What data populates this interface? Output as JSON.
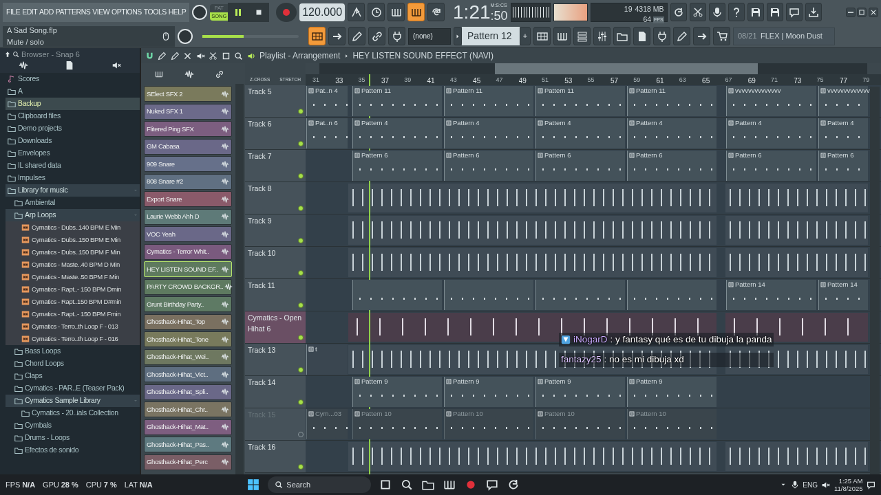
{
  "menu": [
    "FILE",
    "EDIT",
    "ADD",
    "PATTERNS",
    "VIEW",
    "OPTIONS",
    "TOOLS",
    "HELP"
  ],
  "mode": [
    {
      "label": "PAT",
      "selected": false
    },
    {
      "label": "SONG",
      "selected": true
    }
  ],
  "transport": {
    "playing": true,
    "tempo": "120.000"
  },
  "toggles": [
    {
      "on": false
    },
    {
      "on": false
    },
    {
      "on": false
    },
    {
      "on": true
    },
    {
      "on": false
    }
  ],
  "time": {
    "value": "1:21",
    "sub": ":50",
    "unit": "M:S:CS"
  },
  "cpu": {
    "polyphony": "19",
    "memory": "4318 MB",
    "fps": "64",
    "fps_label": "FPS"
  },
  "project": {
    "file": "A Sad Song.flp",
    "hint": "Mute / solo"
  },
  "master_volume": {
    "level": 0.43
  },
  "tool_toggles": [
    {
      "on": true
    },
    {
      "on": false
    },
    {
      "on": false
    },
    {
      "on": false
    },
    {
      "on": false
    }
  ],
  "pattern_picker": {
    "preset": "(none)",
    "pattern": "Pattern 12",
    "add": "+"
  },
  "news": {
    "counter": "08/21",
    "title": "FLEX | Moon Dust"
  },
  "browser": {
    "title": "Browser - Snap 6",
    "items": [
      {
        "label": "Scores",
        "kind": "score",
        "selected": false
      },
      {
        "label": "A",
        "kind": "folder",
        "selected": false
      },
      {
        "label": "Backup",
        "kind": "folder",
        "selected": true
      },
      {
        "label": "Clipboard files",
        "kind": "folder",
        "selected": false
      },
      {
        "label": "Demo projects",
        "kind": "folder",
        "selected": false
      },
      {
        "label": "Downloads",
        "kind": "folder",
        "selected": false
      },
      {
        "label": "Envelopes",
        "kind": "folder",
        "selected": false
      },
      {
        "label": "IL shared data",
        "kind": "folder",
        "selected": false
      },
      {
        "label": "Impulses",
        "kind": "folder",
        "selected": false
      },
      {
        "label": "Library for music",
        "kind": "folder",
        "selected": false,
        "children": [
          {
            "label": "Ambiental",
            "kind": "folder",
            "selected": false
          },
          {
            "label": "Arp Loops",
            "kind": "folder",
            "selected": false,
            "children": [
              {
                "label": "Cymatics - Dubs..140 BPM E Min",
                "kind": "file",
                "selected": false
              },
              {
                "label": "Cymatics - Dubs..150 BPM E Min",
                "kind": "file",
                "selected": false
              },
              {
                "label": "Cymatics - Dubs..150 BPM F Min",
                "kind": "file",
                "selected": false
              },
              {
                "label": "Cymatics - Maste..40 BPM D Min",
                "kind": "file",
                "selected": false
              },
              {
                "label": "Cymatics - Maste..50 BPM F Min",
                "kind": "file",
                "selected": false
              },
              {
                "label": "Cymatics - Rapt..- 150 BPM Dmin",
                "kind": "file",
                "selected": false
              },
              {
                "label": "Cymatics - Rapt..150 BPM D#min",
                "kind": "file",
                "selected": false
              },
              {
                "label": "Cymatics - Rapt..- 150 BPM Fmin",
                "kind": "file",
                "selected": false
              },
              {
                "label": "Cymatics - Terro..th Loop F  - 013",
                "kind": "file",
                "selected": false
              },
              {
                "label": "Cymatics - Terro..th Loop F  - 016",
                "kind": "file",
                "selected": false
              }
            ]
          },
          {
            "label": "Bass Loops",
            "kind": "folder",
            "selected": false
          },
          {
            "label": "Chord Loops",
            "kind": "folder",
            "selected": false
          },
          {
            "label": "Claps",
            "kind": "folder",
            "selected": false
          },
          {
            "label": "Cymatics - PAR..E (Teaser Pack)",
            "kind": "folder",
            "selected": false
          },
          {
            "label": "Cymatics Sample Library",
            "kind": "folder",
            "selected": false,
            "children": [
              {
                "label": "Cymatics - 20..ials Collection",
                "kind": "folder",
                "selected": false
              }
            ]
          },
          {
            "label": "Cymbals",
            "kind": "folder",
            "selected": false
          },
          {
            "label": "Drums - Loops",
            "kind": "folder",
            "selected": false
          },
          {
            "label": "Efectos de sonido",
            "kind": "folder",
            "selected": false
          }
        ]
      }
    ]
  },
  "channels": [
    {
      "name": "SElect SFX 2",
      "color": "#7a7a5c",
      "selected": false
    },
    {
      "name": "Nuked SFX 1",
      "color": "#6c6a8a",
      "selected": false
    },
    {
      "name": "Flitered Ping SFX",
      "color": "#7c5e80",
      "selected": false
    },
    {
      "name": "GM Cabasa",
      "color": "#6a6888",
      "selected": false
    },
    {
      "name": "909 Snare",
      "color": "#66708a",
      "selected": false
    },
    {
      "name": "808 Snare #2",
      "color": "#607082",
      "selected": false
    },
    {
      "name": "Export Snare",
      "color": "#8a5a6a",
      "selected": false
    },
    {
      "name": "Laurie Webb Ahh D",
      "color": "#5e7a78",
      "selected": false
    },
    {
      "name": "VOC Yeah",
      "color": "#6a6888",
      "selected": false
    },
    {
      "name": "Cymatics - Terror Whit..",
      "color": "#7a5a7e",
      "selected": false
    },
    {
      "name": "HEY LISTEN SOUND EF..",
      "color": "#5e7a5e",
      "selected": true
    },
    {
      "name": "PARTY CROWD BACKGR..",
      "color": "#5e7a60",
      "selected": false
    },
    {
      "name": "Grunt Birthday Party..",
      "color": "#5e7a64",
      "selected": false
    },
    {
      "name": "Ghosthack-Hihat_Top",
      "color": "#7a7060",
      "selected": false
    },
    {
      "name": "Ghosthack-Hihat_Tone",
      "color": "#787a5c",
      "selected": false
    },
    {
      "name": "Ghosthack-Hihat_Wei..",
      "color": "#6e7860",
      "selected": false
    },
    {
      "name": "Ghosthack-Hihat_Vict..",
      "color": "#5e6e80",
      "selected": false
    },
    {
      "name": "Ghosthack-Hihat_Spli..",
      "color": "#6a6888",
      "selected": false
    },
    {
      "name": "Ghosthack-Hihat_Chr..",
      "color": "#7a7462",
      "selected": false
    },
    {
      "name": "Ghosthack-Hihat_Mat..",
      "color": "#7e5e80",
      "selected": false
    },
    {
      "name": "Ghosthack-Hihat_Pas..",
      "color": "#5e7a80",
      "selected": false
    },
    {
      "name": "Ghosthack-Hihat_Perc",
      "color": "#7a5e66",
      "selected": false
    }
  ],
  "playlist": {
    "title": "Playlist - Arrangement",
    "clip_source": "HEY LISTEN SOUND EFFECT (NAVI)",
    "stretch_labels": [
      "Z-CROSS",
      "STRETCH"
    ],
    "ruler": [
      "31",
      "33",
      "35",
      "37",
      "39",
      "41",
      "43",
      "45",
      "47",
      "49",
      "51",
      "53",
      "55",
      "57",
      "59",
      "61",
      "63",
      "65",
      "67",
      "69",
      "71",
      "73",
      "75",
      "77",
      "79"
    ],
    "tracks": [
      {
        "name": "Track 5",
        "kind": "pattern",
        "muted": false,
        "highlighted": false,
        "clips": [
          {
            "kind": "intro",
            "label": "Pat..n 4"
          },
          {
            "kind": "main",
            "label": "Pattern 11"
          },
          {
            "kind": "main",
            "label": "Pattern 11"
          },
          {
            "kind": "main",
            "label": "Pattern 11"
          },
          {
            "kind": "main",
            "label": "Pattern 11"
          },
          {
            "kind": "tail",
            "label": "vvvvvvvvvvvvvv"
          },
          {
            "kind": "tail",
            "label": "vvvvvvvvvvvvv"
          }
        ]
      },
      {
        "name": "Track 6",
        "kind": "pattern",
        "muted": false,
        "highlighted": false,
        "clips": [
          {
            "kind": "intro",
            "label": "Pat..n 6"
          },
          {
            "kind": "main",
            "label": "Pattern 4"
          },
          {
            "kind": "main",
            "label": "Pattern 4"
          },
          {
            "kind": "main",
            "label": "Pattern 4"
          },
          {
            "kind": "main",
            "label": "Pattern 4"
          },
          {
            "kind": "tail",
            "label": "Pattern 4"
          },
          {
            "kind": "tail",
            "label": "Pattern 4"
          }
        ]
      },
      {
        "name": "Track 7",
        "kind": "pattern",
        "muted": false,
        "highlighted": false,
        "clips": [
          {
            "kind": "main",
            "label": "Pattern 6"
          },
          {
            "kind": "main",
            "label": "Pattern 6"
          },
          {
            "kind": "main",
            "label": "Pattern 6"
          },
          {
            "kind": "main",
            "label": "Pattern 6"
          },
          {
            "kind": "tail",
            "label": "Pattern 6"
          },
          {
            "kind": "tail",
            "label": "Pattern 6"
          }
        ]
      },
      {
        "name": "Track 8",
        "kind": "audio",
        "muted": false,
        "highlighted": false
      },
      {
        "name": "Track 9",
        "kind": "audio",
        "muted": false,
        "highlighted": false
      },
      {
        "name": "Track 10",
        "kind": "audio",
        "muted": false,
        "highlighted": false
      },
      {
        "name": "Track 11",
        "kind": "pattern",
        "muted": false,
        "highlighted": false,
        "clips": [
          {
            "kind": "blank"
          },
          {
            "kind": "blank"
          },
          {
            "kind": "blank"
          },
          {
            "kind": "blank"
          },
          {
            "kind": "tail",
            "label": "Pattern 14"
          },
          {
            "kind": "tail",
            "label": "Pattern 14"
          }
        ]
      },
      {
        "name": "Cymatics - Open Hihat 6",
        "kind": "audio",
        "muted": false,
        "highlighted": true
      },
      {
        "name": "Track 13",
        "kind": "audio",
        "muted": false,
        "highlighted": false,
        "clips": [
          {
            "kind": "intro",
            "label": "t"
          }
        ]
      },
      {
        "name": "Track 14",
        "kind": "pattern",
        "muted": false,
        "highlighted": false,
        "clips": [
          {
            "kind": "main",
            "label": "Pattern 9"
          },
          {
            "kind": "main",
            "label": "Pattern 9"
          },
          {
            "kind": "main",
            "label": "Pattern 9"
          },
          {
            "kind": "main",
            "label": "Pattern 9"
          }
        ]
      },
      {
        "name": "Track 15",
        "kind": "pattern",
        "muted": true,
        "highlighted": false,
        "clips": [
          {
            "kind": "intro",
            "label": "Cym...03"
          },
          {
            "kind": "main",
            "label": "Pattern 10"
          },
          {
            "kind": "main",
            "label": "Pattern 10"
          },
          {
            "kind": "main",
            "label": "Pattern 10"
          },
          {
            "kind": "main",
            "label": "Pattern 10"
          }
        ]
      },
      {
        "name": "Track 16",
        "kind": "audio",
        "muted": false,
        "highlighted": false
      }
    ]
  },
  "chat": [
    {
      "user": "iNogarD",
      "message": ": y fantasy qué es de tu dibuja la panda",
      "color": "#c9a9ff",
      "badge": true
    },
    {
      "user": "fantazy25",
      "message": ": no es mi dibuja xd",
      "color": "#dcc4ff",
      "badge": false
    }
  ],
  "status": [
    {
      "label": "FPS",
      "value": "N/A"
    },
    {
      "label": "GPU",
      "value": "28 %"
    },
    {
      "label": "CPU",
      "value": "7 %"
    },
    {
      "label": "LAT",
      "value": "N/A"
    }
  ],
  "taskbar": {
    "search": "Search",
    "language": "ENG",
    "time": "1:25 AM",
    "date": "11/8/2025"
  }
}
